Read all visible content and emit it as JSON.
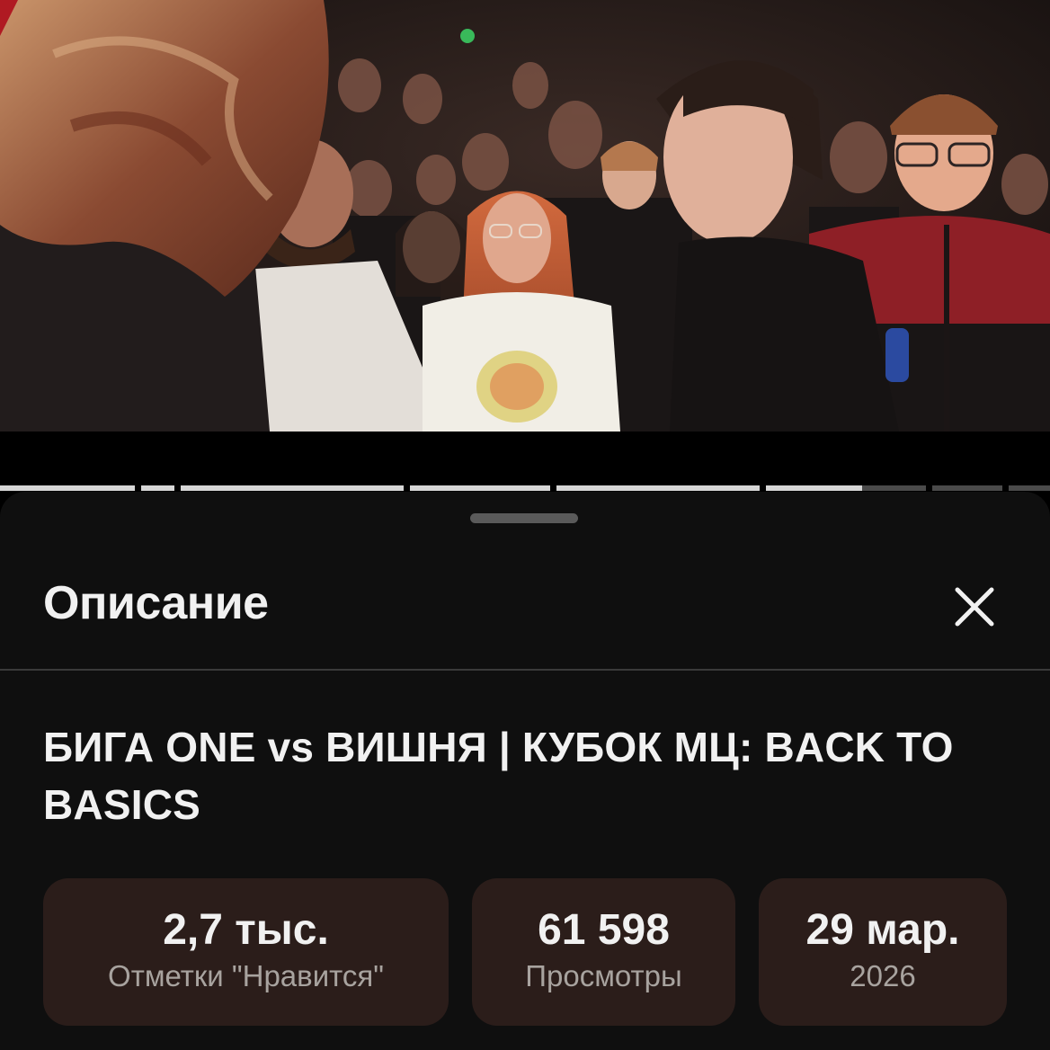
{
  "player": {
    "chapter_progress_fractions": [
      1,
      1,
      1,
      1,
      1,
      1,
      0.6,
      0,
      0,
      0
    ]
  },
  "sheet": {
    "title": "Описание",
    "close_icon": "close-icon"
  },
  "video": {
    "title": "БИГА ONE vs ВИШНЯ | КУБОК МЦ: BACK TO BASICS"
  },
  "stats": [
    {
      "value": "2,7 тыс.",
      "label": "Отметки \"Нравится\""
    },
    {
      "value": "61 598",
      "label": "Просмотры"
    },
    {
      "value": "29 мар.",
      "label": "2026"
    }
  ],
  "colors": {
    "sheet_bg": "#0f0f0f",
    "card_bg": "#2b1d1a",
    "text_primary": "#f1f1f1",
    "text_secondary": "#a8a39f"
  }
}
